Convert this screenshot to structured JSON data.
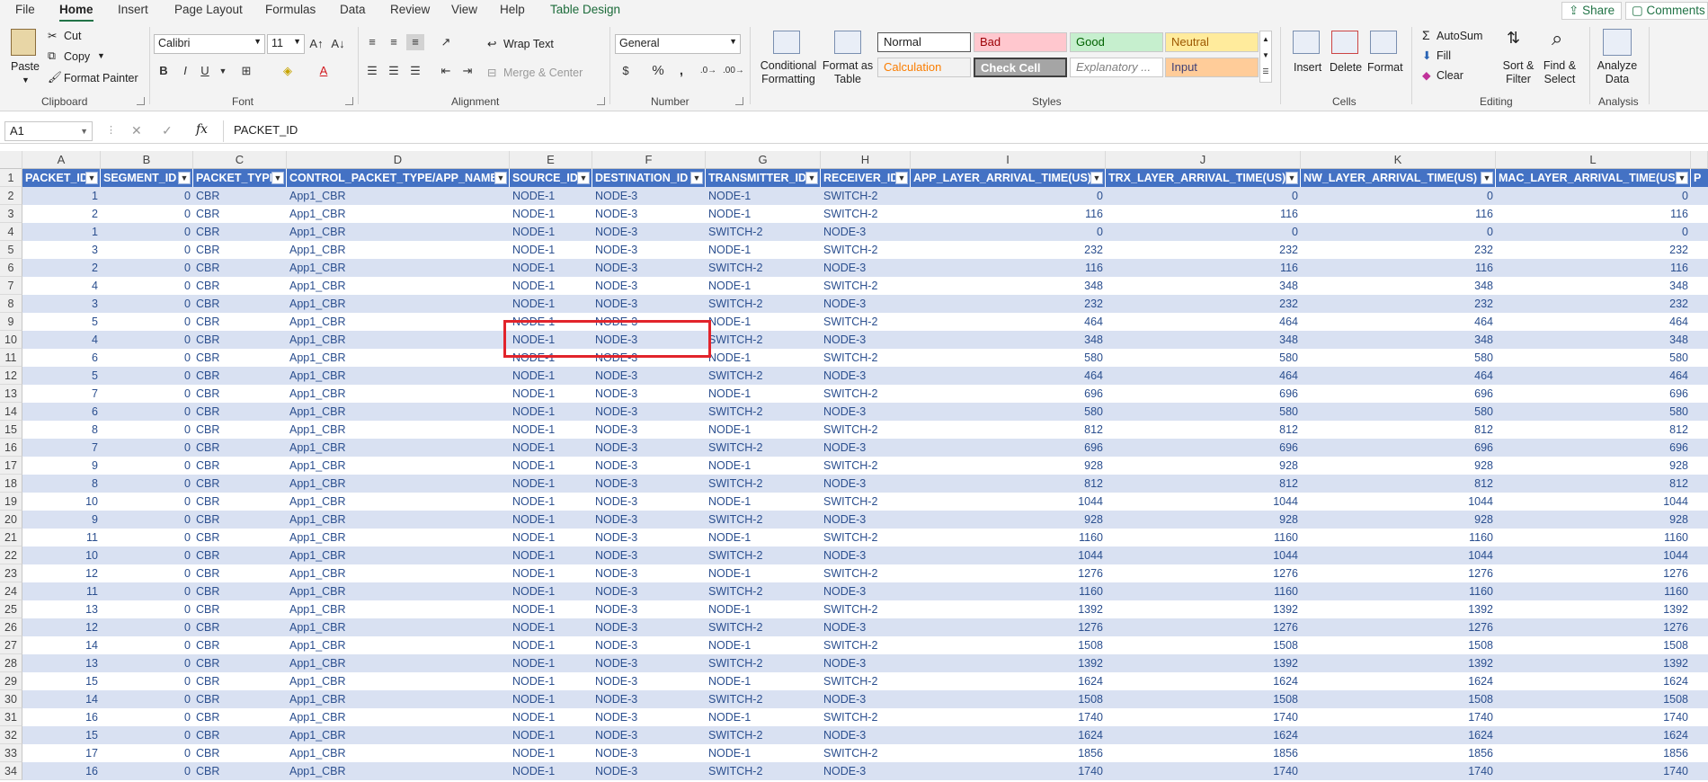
{
  "ribbon_tabs": [
    "File",
    "Home",
    "Insert",
    "Page Layout",
    "Formulas",
    "Data",
    "Review",
    "View",
    "Help",
    "Table Design"
  ],
  "share_label": "Share",
  "comments_label": "Comments",
  "clipboard": {
    "paste": "Paste",
    "cut": "Cut",
    "copy": "Copy",
    "format_painter": "Format Painter",
    "group": "Clipboard"
  },
  "font": {
    "name": "Calibri",
    "size": "11",
    "group": "Font",
    "bold": "B",
    "italic": "I",
    "underline": "U"
  },
  "alignment": {
    "wrap": "Wrap Text",
    "merge": "Merge & Center",
    "group": "Alignment"
  },
  "number": {
    "format": "General",
    "group": "Number",
    "percent": "%",
    "comma": ","
  },
  "styles": {
    "conditional": "Conditional Formatting",
    "format_table": "Format as Table",
    "group": "Styles",
    "cells": [
      {
        "label": "Normal",
        "bg": "#ffffff",
        "fg": "#222222"
      },
      {
        "label": "Bad",
        "bg": "#ffc7ce",
        "fg": "#9c0006"
      },
      {
        "label": "Good",
        "bg": "#c6efce",
        "fg": "#006100"
      },
      {
        "label": "Neutral",
        "bg": "#ffeb9c",
        "fg": "#9c5700"
      },
      {
        "label": "Calculation",
        "bg": "#f2f2f2",
        "fg": "#fa7d00"
      },
      {
        "label": "Check Cell",
        "bg": "#a5a5a5",
        "fg": "#ffffff"
      },
      {
        "label": "Explanatory ...",
        "bg": "#ffffff",
        "fg": "#7f7f7f"
      },
      {
        "label": "Input",
        "bg": "#ffcc99",
        "fg": "#3f3f76"
      }
    ]
  },
  "cells_group": {
    "insert": "Insert",
    "delete": "Delete",
    "format": "Format",
    "group": "Cells"
  },
  "editing": {
    "autosum": "AutoSum",
    "fill": "Fill",
    "clear": "Clear",
    "sort": "Sort & Filter",
    "find": "Find & Select",
    "group": "Editing"
  },
  "analysis": {
    "analyze": "Analyze Data",
    "group": "Analysis"
  },
  "namebox": "A1",
  "formula": "PACKET_ID",
  "columns": [
    "A",
    "B",
    "C",
    "D",
    "E",
    "F",
    "G",
    "H",
    "I",
    "J",
    "K",
    "L"
  ],
  "headers": [
    "PACKET_ID",
    "SEGMENT_ID",
    "PACKET_TYPE",
    "CONTROL_PACKET_TYPE/APP_NAME",
    "SOURCE_ID",
    "DESTINATION_ID",
    "TRANSMITTER_ID",
    "RECEIVER_ID",
    "APP_LAYER_ARRIVAL_TIME(US)",
    "TRX_LAYER_ARRIVAL_TIME(US)",
    "NW_LAYER_ARRIVAL_TIME(US)",
    "MAC_LAYER_ARRIVAL_TIME(US)"
  ],
  "rows": [
    [
      "1",
      "0",
      "CBR",
      "App1_CBR",
      "NODE-1",
      "NODE-3",
      "NODE-1",
      "SWITCH-2",
      "0",
      "0",
      "0",
      "0"
    ],
    [
      "2",
      "0",
      "CBR",
      "App1_CBR",
      "NODE-1",
      "NODE-3",
      "NODE-1",
      "SWITCH-2",
      "116",
      "116",
      "116",
      "116"
    ],
    [
      "1",
      "0",
      "CBR",
      "App1_CBR",
      "NODE-1",
      "NODE-3",
      "SWITCH-2",
      "NODE-3",
      "0",
      "0",
      "0",
      "0"
    ],
    [
      "3",
      "0",
      "CBR",
      "App1_CBR",
      "NODE-1",
      "NODE-3",
      "NODE-1",
      "SWITCH-2",
      "232",
      "232",
      "232",
      "232"
    ],
    [
      "2",
      "0",
      "CBR",
      "App1_CBR",
      "NODE-1",
      "NODE-3",
      "SWITCH-2",
      "NODE-3",
      "116",
      "116",
      "116",
      "116"
    ],
    [
      "4",
      "0",
      "CBR",
      "App1_CBR",
      "NODE-1",
      "NODE-3",
      "NODE-1",
      "SWITCH-2",
      "348",
      "348",
      "348",
      "348"
    ],
    [
      "3",
      "0",
      "CBR",
      "App1_CBR",
      "NODE-1",
      "NODE-3",
      "SWITCH-2",
      "NODE-3",
      "232",
      "232",
      "232",
      "232"
    ],
    [
      "5",
      "0",
      "CBR",
      "App1_CBR",
      "NODE-1",
      "NODE-3",
      "NODE-1",
      "SWITCH-2",
      "464",
      "464",
      "464",
      "464"
    ],
    [
      "4",
      "0",
      "CBR",
      "App1_CBR",
      "NODE-1",
      "NODE-3",
      "SWITCH-2",
      "NODE-3",
      "348",
      "348",
      "348",
      "348"
    ],
    [
      "6",
      "0",
      "CBR",
      "App1_CBR",
      "NODE-1",
      "NODE-3",
      "NODE-1",
      "SWITCH-2",
      "580",
      "580",
      "580",
      "580"
    ],
    [
      "5",
      "0",
      "CBR",
      "App1_CBR",
      "NODE-1",
      "NODE-3",
      "SWITCH-2",
      "NODE-3",
      "464",
      "464",
      "464",
      "464"
    ],
    [
      "7",
      "0",
      "CBR",
      "App1_CBR",
      "NODE-1",
      "NODE-3",
      "NODE-1",
      "SWITCH-2",
      "696",
      "696",
      "696",
      "696"
    ],
    [
      "6",
      "0",
      "CBR",
      "App1_CBR",
      "NODE-1",
      "NODE-3",
      "SWITCH-2",
      "NODE-3",
      "580",
      "580",
      "580",
      "580"
    ],
    [
      "8",
      "0",
      "CBR",
      "App1_CBR",
      "NODE-1",
      "NODE-3",
      "NODE-1",
      "SWITCH-2",
      "812",
      "812",
      "812",
      "812"
    ],
    [
      "7",
      "0",
      "CBR",
      "App1_CBR",
      "NODE-1",
      "NODE-3",
      "SWITCH-2",
      "NODE-3",
      "696",
      "696",
      "696",
      "696"
    ],
    [
      "9",
      "0",
      "CBR",
      "App1_CBR",
      "NODE-1",
      "NODE-3",
      "NODE-1",
      "SWITCH-2",
      "928",
      "928",
      "928",
      "928"
    ],
    [
      "8",
      "0",
      "CBR",
      "App1_CBR",
      "NODE-1",
      "NODE-3",
      "SWITCH-2",
      "NODE-3",
      "812",
      "812",
      "812",
      "812"
    ],
    [
      "10",
      "0",
      "CBR",
      "App1_CBR",
      "NODE-1",
      "NODE-3",
      "NODE-1",
      "SWITCH-2",
      "1044",
      "1044",
      "1044",
      "1044"
    ],
    [
      "9",
      "0",
      "CBR",
      "App1_CBR",
      "NODE-1",
      "NODE-3",
      "SWITCH-2",
      "NODE-3",
      "928",
      "928",
      "928",
      "928"
    ],
    [
      "11",
      "0",
      "CBR",
      "App1_CBR",
      "NODE-1",
      "NODE-3",
      "NODE-1",
      "SWITCH-2",
      "1160",
      "1160",
      "1160",
      "1160"
    ],
    [
      "10",
      "0",
      "CBR",
      "App1_CBR",
      "NODE-1",
      "NODE-3",
      "SWITCH-2",
      "NODE-3",
      "1044",
      "1044",
      "1044",
      "1044"
    ],
    [
      "12",
      "0",
      "CBR",
      "App1_CBR",
      "NODE-1",
      "NODE-3",
      "NODE-1",
      "SWITCH-2",
      "1276",
      "1276",
      "1276",
      "1276"
    ],
    [
      "11",
      "0",
      "CBR",
      "App1_CBR",
      "NODE-1",
      "NODE-3",
      "SWITCH-2",
      "NODE-3",
      "1160",
      "1160",
      "1160",
      "1160"
    ],
    [
      "13",
      "0",
      "CBR",
      "App1_CBR",
      "NODE-1",
      "NODE-3",
      "NODE-1",
      "SWITCH-2",
      "1392",
      "1392",
      "1392",
      "1392"
    ],
    [
      "12",
      "0",
      "CBR",
      "App1_CBR",
      "NODE-1",
      "NODE-3",
      "SWITCH-2",
      "NODE-3",
      "1276",
      "1276",
      "1276",
      "1276"
    ],
    [
      "14",
      "0",
      "CBR",
      "App1_CBR",
      "NODE-1",
      "NODE-3",
      "NODE-1",
      "SWITCH-2",
      "1508",
      "1508",
      "1508",
      "1508"
    ],
    [
      "13",
      "0",
      "CBR",
      "App1_CBR",
      "NODE-1",
      "NODE-3",
      "SWITCH-2",
      "NODE-3",
      "1392",
      "1392",
      "1392",
      "1392"
    ],
    [
      "15",
      "0",
      "CBR",
      "App1_CBR",
      "NODE-1",
      "NODE-3",
      "NODE-1",
      "SWITCH-2",
      "1624",
      "1624",
      "1624",
      "1624"
    ],
    [
      "14",
      "0",
      "CBR",
      "App1_CBR",
      "NODE-1",
      "NODE-3",
      "SWITCH-2",
      "NODE-3",
      "1508",
      "1508",
      "1508",
      "1508"
    ],
    [
      "16",
      "0",
      "CBR",
      "App1_CBR",
      "NODE-1",
      "NODE-3",
      "NODE-1",
      "SWITCH-2",
      "1740",
      "1740",
      "1740",
      "1740"
    ],
    [
      "15",
      "0",
      "CBR",
      "App1_CBR",
      "NODE-1",
      "NODE-3",
      "SWITCH-2",
      "NODE-3",
      "1624",
      "1624",
      "1624",
      "1624"
    ],
    [
      "17",
      "0",
      "CBR",
      "App1_CBR",
      "NODE-1",
      "NODE-3",
      "NODE-1",
      "SWITCH-2",
      "1856",
      "1856",
      "1856",
      "1856"
    ],
    [
      "16",
      "0",
      "CBR",
      "App1_CBR",
      "NODE-1",
      "NODE-3",
      "SWITCH-2",
      "NODE-3",
      "1740",
      "1740",
      "1740",
      "1740"
    ]
  ],
  "numeric_columns": [
    0,
    1,
    8,
    9,
    10,
    11
  ],
  "next_column_hint": "P"
}
